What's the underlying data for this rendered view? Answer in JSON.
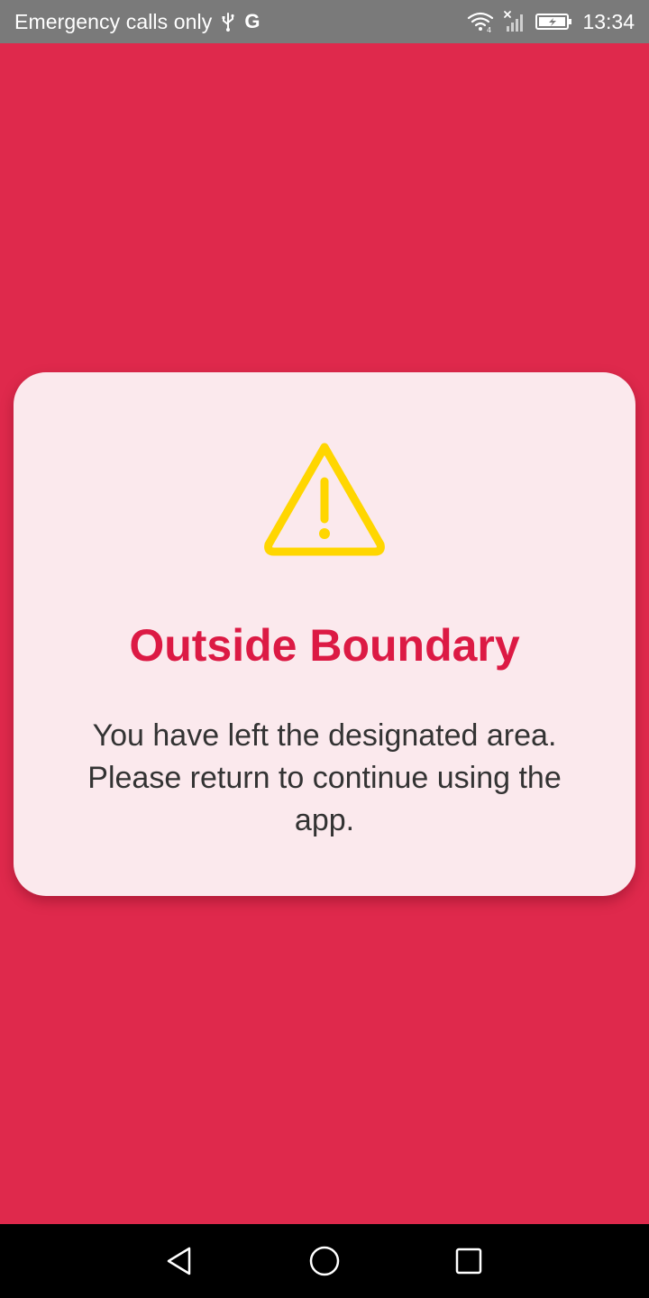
{
  "status_bar": {
    "carrier_text": "Emergency calls only",
    "time": "13:34",
    "g_indicator": "G",
    "icons": [
      "usb-icon",
      "google-icon",
      "wifi-icon",
      "signal-icon",
      "battery-icon"
    ]
  },
  "dialog": {
    "icon": "warning-icon",
    "title": "Outside Boundary",
    "message": "You have left the designated area. Please return to continue using the app."
  },
  "nav_bar": {
    "buttons": [
      "back-button",
      "home-button",
      "recents-button"
    ]
  },
  "colors": {
    "background": "#DF294C",
    "card": "#FBE9ED",
    "title": "#DC1A44",
    "warning": "#FFD600",
    "message": "#333333",
    "status_bar": "#7A7A7A",
    "nav_bar": "#000000"
  }
}
